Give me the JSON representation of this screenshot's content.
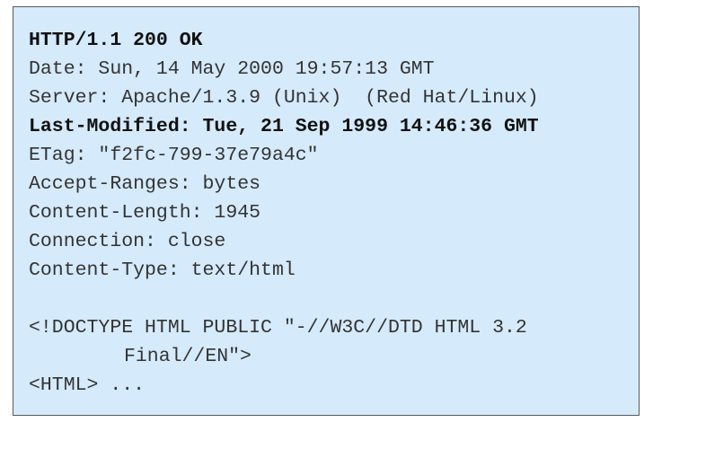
{
  "http_response": {
    "status_line": "HTTP/1.1 200 OK",
    "headers": [
      "Date: Sun, 14 May 2000 19:57:13 GMT",
      "Server: Apache/1.3.9 (Unix)  (Red Hat/Linux)",
      "Last-Modified: Tue, 21 Sep 1999 14:46:36 GMT",
      "ETag: \"f2fc-799-37e79a4c\"",
      "Accept-Ranges: bytes",
      "Content-Length: 1945",
      "Connection: close",
      "Content-Type: text/html"
    ],
    "body_lines": [
      "<!DOCTYPE HTML PUBLIC \"-//W3C//DTD HTML 3.2",
      "Final//EN\">",
      "<HTML> ..."
    ]
  },
  "colors": {
    "box_background": "#d5eafb",
    "box_border": "#5a5a5a",
    "text": "#333333",
    "text_bold": "#111111"
  }
}
